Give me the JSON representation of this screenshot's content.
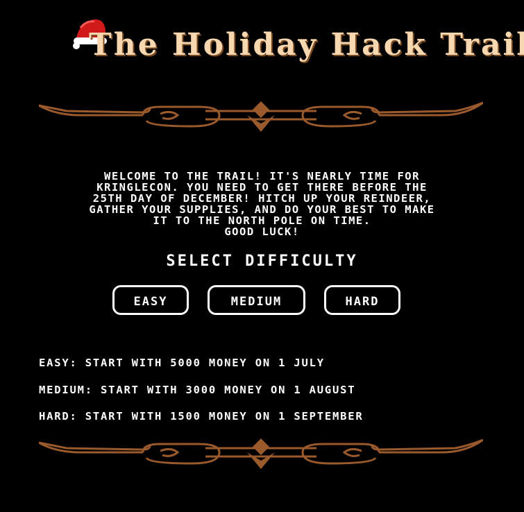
{
  "title": "The Holiday Hack Trail",
  "intro": {
    "line1": "Welcome to the Trail! It's nearly time for",
    "line2": "KringleCon. You need to get there before the",
    "line3": "25th day of December! Hitch up your reindeer,",
    "line4": "gather your supplies, and do your best to make",
    "line5": "it to the North Pole on time.",
    "line6": "Good luck!"
  },
  "select_heading": "Select Difficulty",
  "buttons": {
    "easy": "Easy",
    "medium": "Medium",
    "hard": "Hard"
  },
  "difficulty_info": {
    "easy": "Easy: Start with 5000 money on 1 July",
    "medium": "Medium: Start with 3000 money on 1 August",
    "hard": "Hard: Start with 1500 money on 1 September"
  },
  "colors": {
    "background": "#000000",
    "title": "#f7d7b0",
    "ornament": "#9a5a2c",
    "text": "#ffffff",
    "hat_red": "#d11a1a"
  },
  "icons": {
    "hat": "santa-hat-icon",
    "divider": "ornamental-divider"
  }
}
